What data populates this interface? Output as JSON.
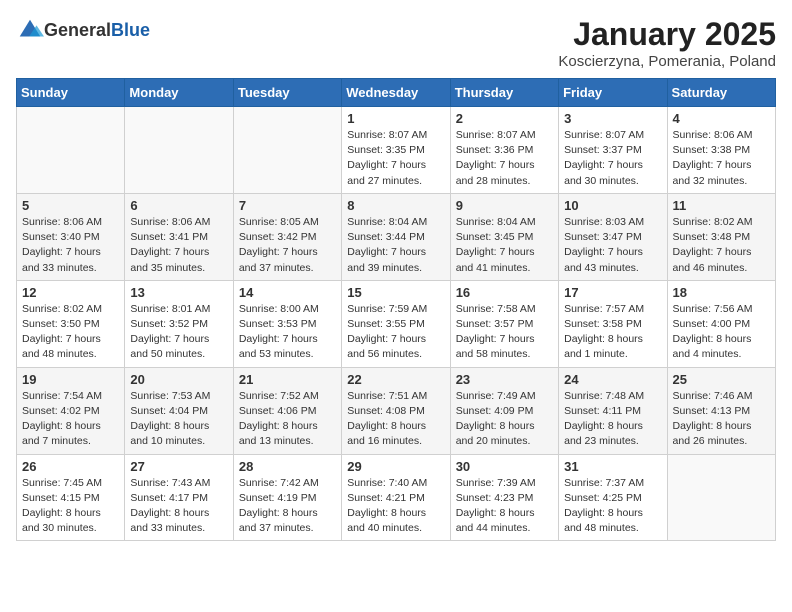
{
  "header": {
    "logo_general": "General",
    "logo_blue": "Blue",
    "main_title": "January 2025",
    "subtitle": "Koscierzyna, Pomerania, Poland"
  },
  "weekdays": [
    "Sunday",
    "Monday",
    "Tuesday",
    "Wednesday",
    "Thursday",
    "Friday",
    "Saturday"
  ],
  "weeks": [
    [
      {
        "day": "",
        "info": ""
      },
      {
        "day": "",
        "info": ""
      },
      {
        "day": "",
        "info": ""
      },
      {
        "day": "1",
        "info": "Sunrise: 8:07 AM\nSunset: 3:35 PM\nDaylight: 7 hours\nand 27 minutes."
      },
      {
        "day": "2",
        "info": "Sunrise: 8:07 AM\nSunset: 3:36 PM\nDaylight: 7 hours\nand 28 minutes."
      },
      {
        "day": "3",
        "info": "Sunrise: 8:07 AM\nSunset: 3:37 PM\nDaylight: 7 hours\nand 30 minutes."
      },
      {
        "day": "4",
        "info": "Sunrise: 8:06 AM\nSunset: 3:38 PM\nDaylight: 7 hours\nand 32 minutes."
      }
    ],
    [
      {
        "day": "5",
        "info": "Sunrise: 8:06 AM\nSunset: 3:40 PM\nDaylight: 7 hours\nand 33 minutes."
      },
      {
        "day": "6",
        "info": "Sunrise: 8:06 AM\nSunset: 3:41 PM\nDaylight: 7 hours\nand 35 minutes."
      },
      {
        "day": "7",
        "info": "Sunrise: 8:05 AM\nSunset: 3:42 PM\nDaylight: 7 hours\nand 37 minutes."
      },
      {
        "day": "8",
        "info": "Sunrise: 8:04 AM\nSunset: 3:44 PM\nDaylight: 7 hours\nand 39 minutes."
      },
      {
        "day": "9",
        "info": "Sunrise: 8:04 AM\nSunset: 3:45 PM\nDaylight: 7 hours\nand 41 minutes."
      },
      {
        "day": "10",
        "info": "Sunrise: 8:03 AM\nSunset: 3:47 PM\nDaylight: 7 hours\nand 43 minutes."
      },
      {
        "day": "11",
        "info": "Sunrise: 8:02 AM\nSunset: 3:48 PM\nDaylight: 7 hours\nand 46 minutes."
      }
    ],
    [
      {
        "day": "12",
        "info": "Sunrise: 8:02 AM\nSunset: 3:50 PM\nDaylight: 7 hours\nand 48 minutes."
      },
      {
        "day": "13",
        "info": "Sunrise: 8:01 AM\nSunset: 3:52 PM\nDaylight: 7 hours\nand 50 minutes."
      },
      {
        "day": "14",
        "info": "Sunrise: 8:00 AM\nSunset: 3:53 PM\nDaylight: 7 hours\nand 53 minutes."
      },
      {
        "day": "15",
        "info": "Sunrise: 7:59 AM\nSunset: 3:55 PM\nDaylight: 7 hours\nand 56 minutes."
      },
      {
        "day": "16",
        "info": "Sunrise: 7:58 AM\nSunset: 3:57 PM\nDaylight: 7 hours\nand 58 minutes."
      },
      {
        "day": "17",
        "info": "Sunrise: 7:57 AM\nSunset: 3:58 PM\nDaylight: 8 hours\nand 1 minute."
      },
      {
        "day": "18",
        "info": "Sunrise: 7:56 AM\nSunset: 4:00 PM\nDaylight: 8 hours\nand 4 minutes."
      }
    ],
    [
      {
        "day": "19",
        "info": "Sunrise: 7:54 AM\nSunset: 4:02 PM\nDaylight: 8 hours\nand 7 minutes."
      },
      {
        "day": "20",
        "info": "Sunrise: 7:53 AM\nSunset: 4:04 PM\nDaylight: 8 hours\nand 10 minutes."
      },
      {
        "day": "21",
        "info": "Sunrise: 7:52 AM\nSunset: 4:06 PM\nDaylight: 8 hours\nand 13 minutes."
      },
      {
        "day": "22",
        "info": "Sunrise: 7:51 AM\nSunset: 4:08 PM\nDaylight: 8 hours\nand 16 minutes."
      },
      {
        "day": "23",
        "info": "Sunrise: 7:49 AM\nSunset: 4:09 PM\nDaylight: 8 hours\nand 20 minutes."
      },
      {
        "day": "24",
        "info": "Sunrise: 7:48 AM\nSunset: 4:11 PM\nDaylight: 8 hours\nand 23 minutes."
      },
      {
        "day": "25",
        "info": "Sunrise: 7:46 AM\nSunset: 4:13 PM\nDaylight: 8 hours\nand 26 minutes."
      }
    ],
    [
      {
        "day": "26",
        "info": "Sunrise: 7:45 AM\nSunset: 4:15 PM\nDaylight: 8 hours\nand 30 minutes."
      },
      {
        "day": "27",
        "info": "Sunrise: 7:43 AM\nSunset: 4:17 PM\nDaylight: 8 hours\nand 33 minutes."
      },
      {
        "day": "28",
        "info": "Sunrise: 7:42 AM\nSunset: 4:19 PM\nDaylight: 8 hours\nand 37 minutes."
      },
      {
        "day": "29",
        "info": "Sunrise: 7:40 AM\nSunset: 4:21 PM\nDaylight: 8 hours\nand 40 minutes."
      },
      {
        "day": "30",
        "info": "Sunrise: 7:39 AM\nSunset: 4:23 PM\nDaylight: 8 hours\nand 44 minutes."
      },
      {
        "day": "31",
        "info": "Sunrise: 7:37 AM\nSunset: 4:25 PM\nDaylight: 8 hours\nand 48 minutes."
      },
      {
        "day": "",
        "info": ""
      }
    ]
  ]
}
